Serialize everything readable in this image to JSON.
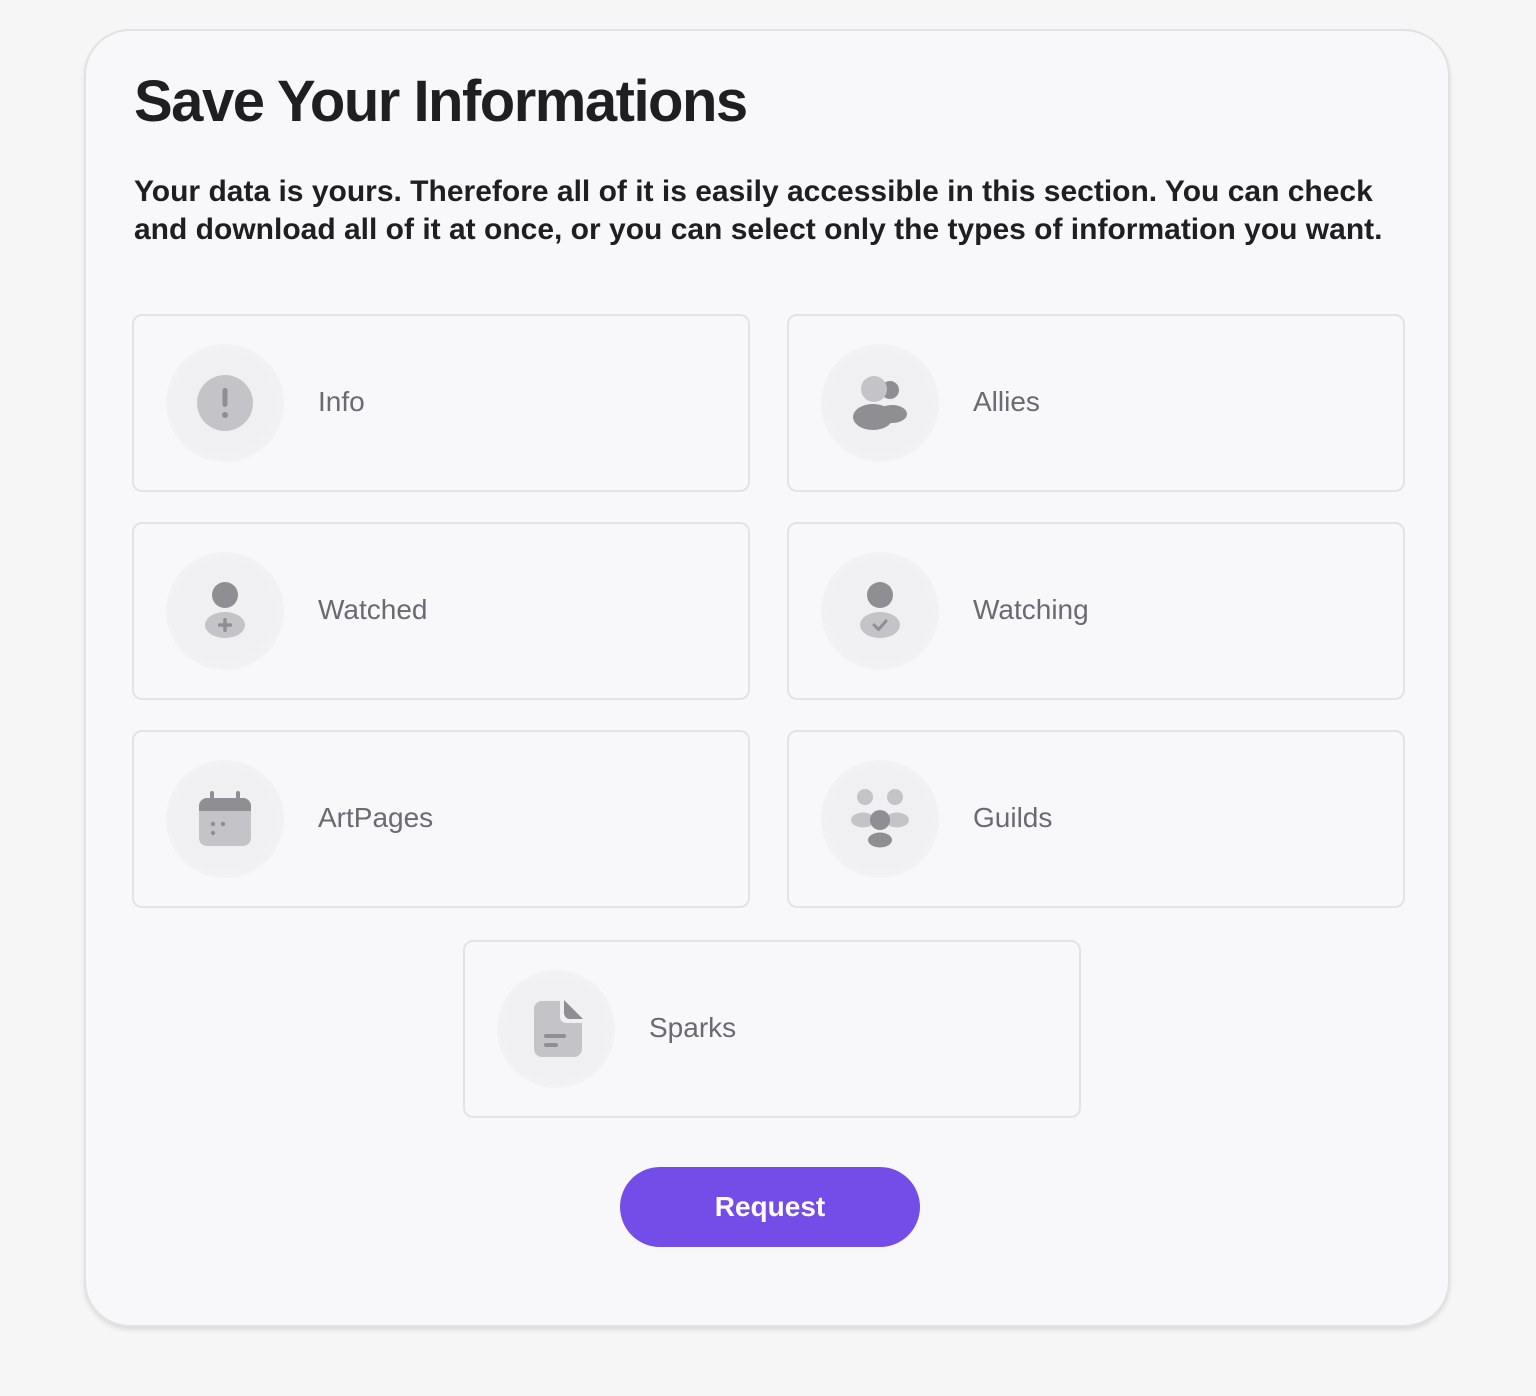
{
  "page": {
    "title": "Save Your Informations",
    "description": "Your data is yours. Therefore all of it is easily accessible in this section. You can check and download all of it at once, or you can select only the types of information you want."
  },
  "options": [
    {
      "label": "Info",
      "icon": "info-icon"
    },
    {
      "label": "Allies",
      "icon": "allies-icon"
    },
    {
      "label": "Watched",
      "icon": "user-plus-icon"
    },
    {
      "label": "Watching",
      "icon": "user-check-icon"
    },
    {
      "label": "ArtPages",
      "icon": "calendar-icon"
    },
    {
      "label": "Guilds",
      "icon": "group-icon"
    },
    {
      "label": "Sparks",
      "icon": "document-icon"
    }
  ],
  "actions": {
    "request_label": "Request"
  },
  "colors": {
    "accent": "#744de8",
    "icon_dark": "#8e8e93",
    "icon_light": "#c4c4c8"
  }
}
